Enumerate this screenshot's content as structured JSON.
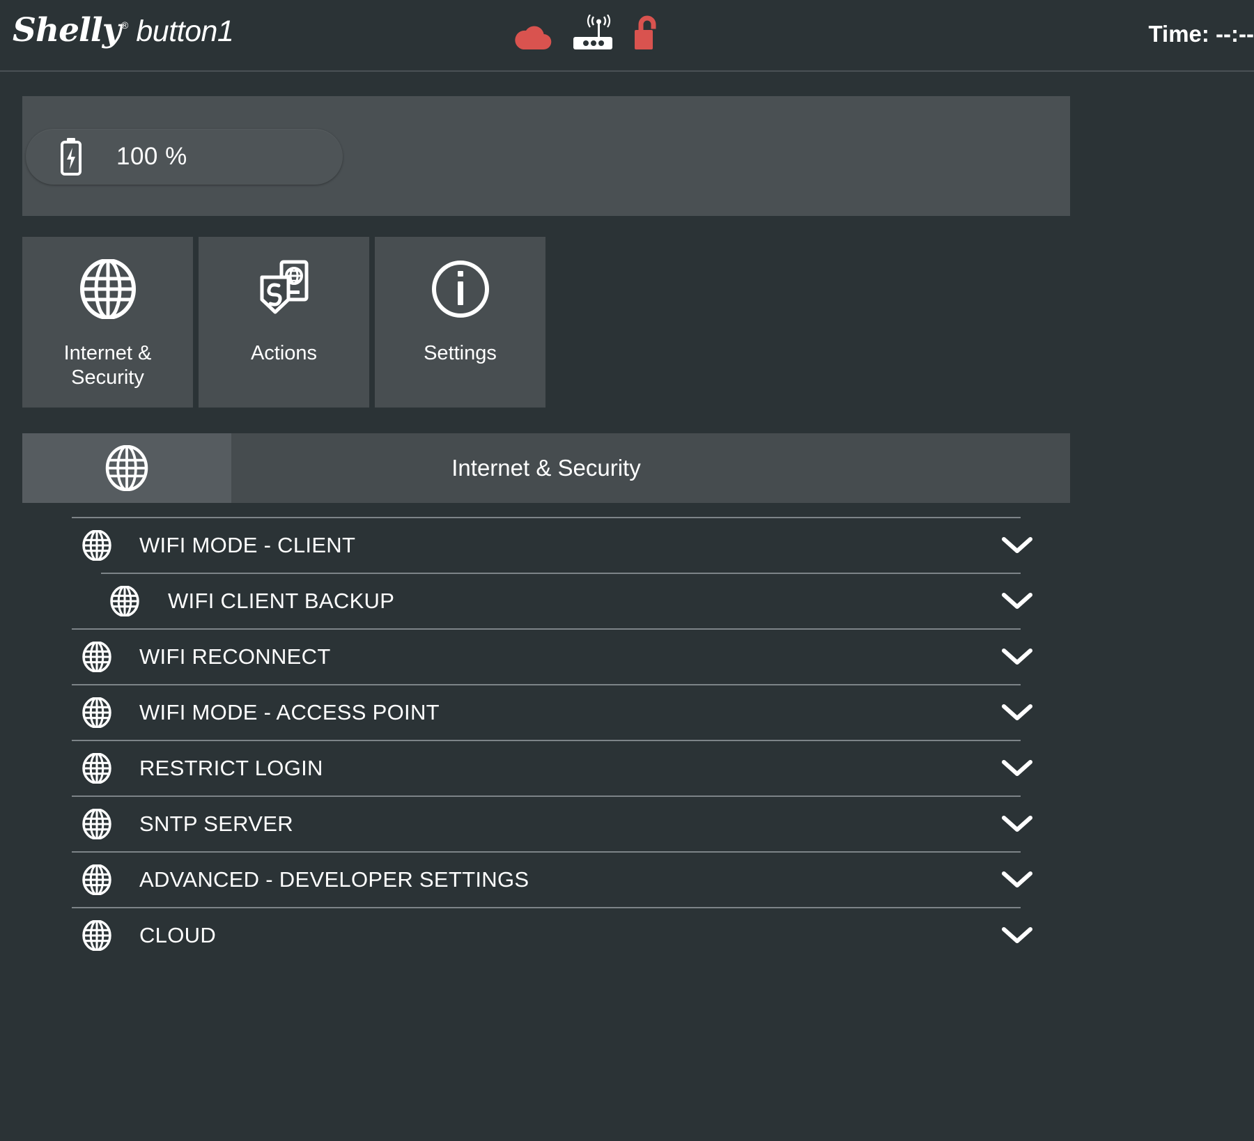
{
  "header": {
    "brand": "Shelly",
    "registered_mark": "®",
    "model": "button1",
    "time_label": "Time: --:--",
    "icons": [
      {
        "name": "cloud-icon",
        "color": "#d9534f"
      },
      {
        "name": "wifi-router-icon",
        "color": "#ffffff"
      },
      {
        "name": "unlocked-padlock-icon",
        "color": "#d9534f"
      }
    ]
  },
  "battery": {
    "icon": "battery-charging-icon",
    "percent": "100 %"
  },
  "tiles": [
    {
      "label_line1": "Internet &",
      "label_line2": "Security",
      "icon": "globe-icon"
    },
    {
      "label_line1": "Actions",
      "label_line2": "",
      "icon": "actions-shield-phone-icon"
    },
    {
      "label_line1": "Settings",
      "label_line2": "",
      "icon": "info-circle-icon"
    }
  ],
  "section": {
    "icon": "globe-icon",
    "title": "Internet & Security"
  },
  "list": [
    {
      "label": "WIFI MODE - CLIENT",
      "icon": "globe-icon",
      "sub": false,
      "chevron": "chevron-down-icon"
    },
    {
      "label": "WIFI CLIENT BACKUP",
      "icon": "globe-icon",
      "sub": true,
      "chevron": "chevron-down-icon"
    },
    {
      "label": "WIFI RECONNECT",
      "icon": "globe-icon",
      "sub": false,
      "chevron": "chevron-down-icon"
    },
    {
      "label": "WIFI MODE - ACCESS POINT",
      "icon": "globe-icon",
      "sub": false,
      "chevron": "chevron-down-icon"
    },
    {
      "label": "RESTRICT LOGIN",
      "icon": "globe-icon",
      "sub": false,
      "chevron": "chevron-down-icon"
    },
    {
      "label": "SNTP SERVER",
      "icon": "globe-icon",
      "sub": false,
      "chevron": "chevron-down-icon"
    },
    {
      "label": "ADVANCED - DEVELOPER SETTINGS",
      "icon": "globe-icon",
      "sub": false,
      "chevron": "chevron-down-icon"
    },
    {
      "label": "CLOUD",
      "icon": "globe-icon",
      "sub": false,
      "chevron": "chevron-down-icon"
    }
  ],
  "colors": {
    "background": "#2b3336",
    "panel": "#4a5053",
    "tile": "#484e51",
    "section_bar": "#464c4f",
    "section_icon_bar": "#565c60",
    "divider": "#7d8488",
    "accent_red": "#d9534f",
    "text": "#ffffff"
  }
}
